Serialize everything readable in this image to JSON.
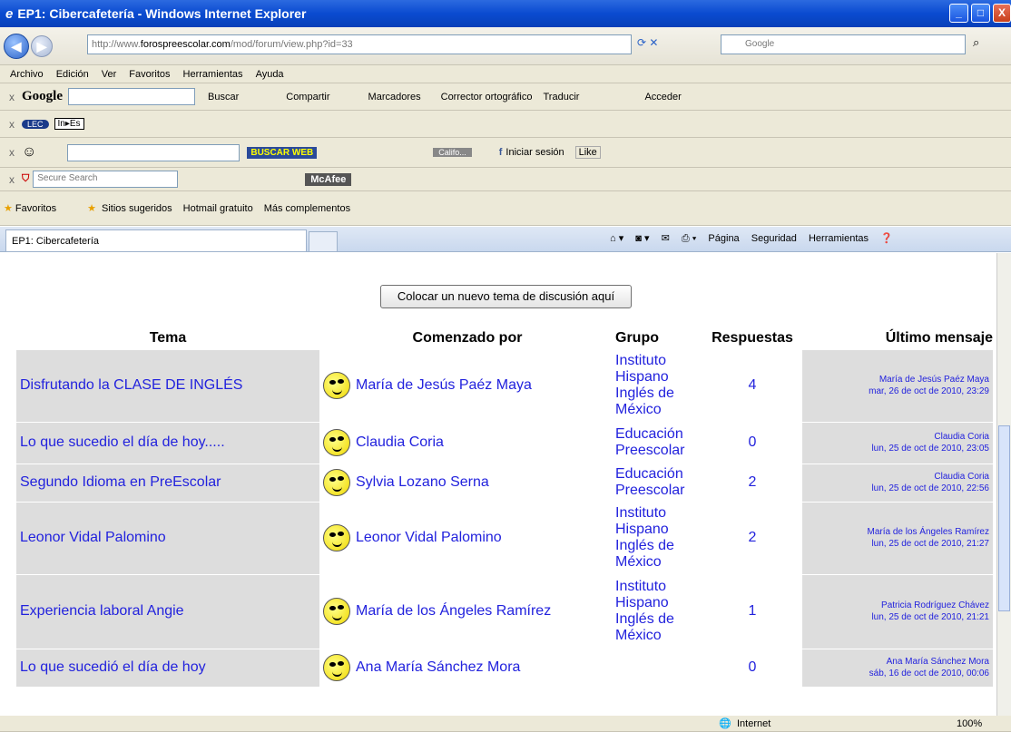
{
  "window": {
    "title": "EP1: Cibercafetería - Windows Internet Explorer"
  },
  "address": {
    "url_prefix": "http://www.",
    "url_domain": "forospreescolar.com",
    "url_path": "/mod/forum/view.php?id=33",
    "search_placeholder": "Google"
  },
  "menu": [
    "Archivo",
    "Edición",
    "Ver",
    "Favoritos",
    "Herramientas",
    "Ayuda"
  ],
  "google_toolbar": {
    "logo": "Google",
    "items": [
      "Buscar",
      "Compartir",
      "Marcadores",
      "Corrector ortográfico",
      "Traducir",
      "Acceder"
    ]
  },
  "lec_toolbar": {
    "label": "In▸Es"
  },
  "buscaweb_toolbar": {
    "logo": "BUSCAR WEB",
    "radio": "Califo...",
    "items": [
      "Iniciar sesión",
      "Like"
    ]
  },
  "mcafee_toolbar": {
    "placeholder": "Secure Search",
    "logo": "McAfee"
  },
  "favorites_bar": {
    "items": [
      "Favoritos",
      "Sitios sugeridos",
      "Hotmail gratuito",
      "Más complementos"
    ]
  },
  "tab": {
    "title": "EP1: Cibercafetería"
  },
  "command_bar": [
    "Página",
    "Seguridad",
    "Herramientas"
  ],
  "page": {
    "post_button": "Colocar un nuevo tema de discusión aquí",
    "headers": {
      "tema": "Tema",
      "comenzado": "Comenzado por",
      "grupo": "Grupo",
      "respuestas": "Respuestas",
      "ultimo": "Último mensaje"
    },
    "rows": [
      {
        "tema": "Disfrutando la CLASE DE INGLÉS",
        "autor": "María de Jesús Paéz Maya",
        "grupo": "Instituto Hispano Inglés de México",
        "respuestas": "4",
        "ultimo_autor": "María de Jesús Paéz Maya",
        "ultimo_fecha": "mar, 26 de oct de 2010, 23:29"
      },
      {
        "tema": "Lo que sucedio el día de hoy.....",
        "autor": "Claudia Coria",
        "grupo": "Educación Preescolar",
        "respuestas": "0",
        "ultimo_autor": "Claudia Coria",
        "ultimo_fecha": "lun, 25 de oct de 2010, 23:05"
      },
      {
        "tema": "Segundo Idioma en PreEscolar",
        "autor": "Sylvia Lozano Serna",
        "grupo": "Educación Preescolar",
        "respuestas": "2",
        "ultimo_autor": "Claudia Coria",
        "ultimo_fecha": "lun, 25 de oct de 2010, 22:56"
      },
      {
        "tema": "Leonor Vidal Palomino",
        "autor": "Leonor Vidal Palomino",
        "grupo": "Instituto Hispano Inglés de México",
        "respuestas": "2",
        "ultimo_autor": "María de los Ángeles Ramírez",
        "ultimo_fecha": "lun, 25 de oct de 2010, 21:27"
      },
      {
        "tema": "Experiencia laboral Angie",
        "autor": "María de los Ángeles Ramírez",
        "grupo": "Instituto Hispano Inglés de México",
        "respuestas": "1",
        "ultimo_autor": "Patricia Rodríguez Chávez",
        "ultimo_fecha": "lun, 25 de oct de 2010, 21:21"
      },
      {
        "tema": "Lo que sucedió el día de hoy",
        "autor": "Ana María Sánchez Mora",
        "grupo": "",
        "respuestas": "0",
        "ultimo_autor": "Ana María Sánchez Mora",
        "ultimo_fecha": "sáb, 16 de oct de 2010, 00:06"
      }
    ]
  },
  "status": {
    "zone": "Internet",
    "zoom": "100%"
  }
}
